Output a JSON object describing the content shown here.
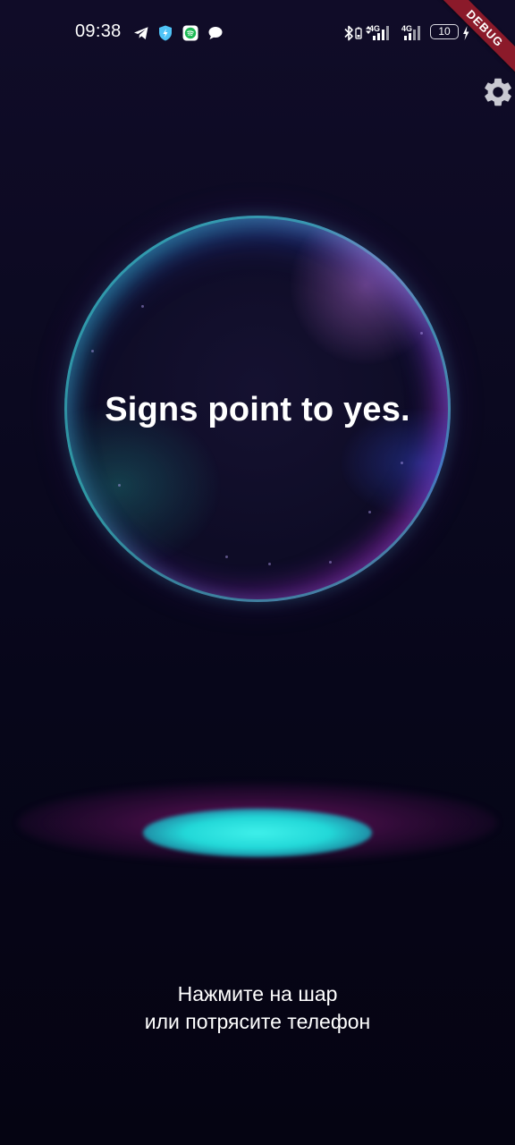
{
  "status_bar": {
    "time": "09:38",
    "notification_icons": [
      "telegram-icon",
      "shield-icon",
      "spotify-icon",
      "message-icon"
    ],
    "network_label_1": "4G",
    "network_label_2": "4G",
    "battery_level": "10"
  },
  "debug_banner": {
    "label": "DEBUG"
  },
  "toolbar": {
    "settings_icon": "gear-icon"
  },
  "ball": {
    "answer": "Signs point to yes."
  },
  "hint": {
    "line1": "Нажмите на шар",
    "line2": "или потрясите телефон"
  },
  "colors": {
    "background_top": "#100c28",
    "background_bottom": "#050412",
    "ball_rim_teal": "#3cc8c8",
    "ball_rim_magenta": "#aa28be",
    "glow_cyan": "#3ff0ea",
    "glow_magenta": "#b41e96",
    "debug_banner": "#8b1a2a"
  }
}
